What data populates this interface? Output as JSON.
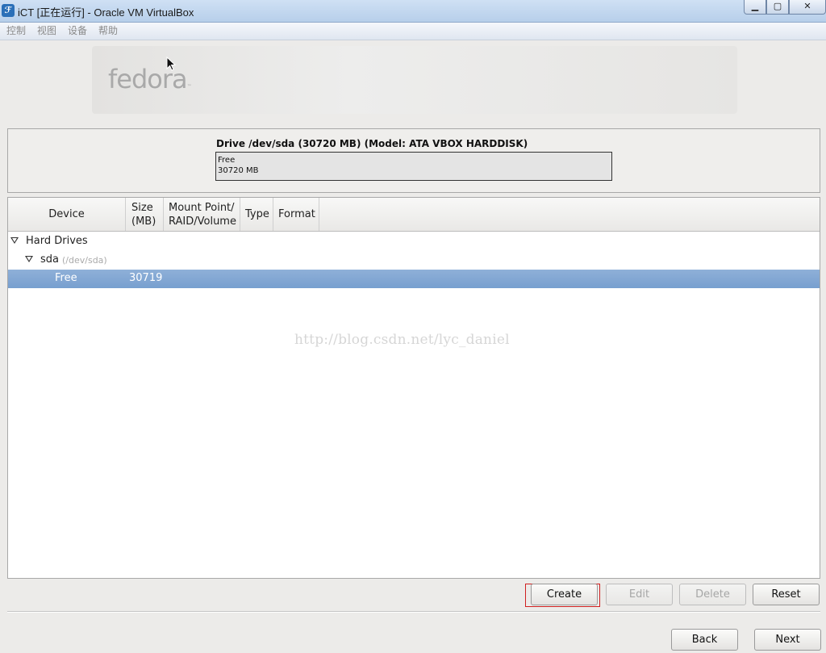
{
  "window": {
    "title": "iCT [正在运行] - Oracle VM VirtualBox",
    "controls": {
      "minimize": "▁",
      "maximize": "▢",
      "close": "✕"
    }
  },
  "menubar": {
    "items": [
      {
        "label": "控制"
      },
      {
        "label": "视图"
      },
      {
        "label": "设备"
      },
      {
        "label": "帮助"
      }
    ]
  },
  "installer": {
    "logo_text": "fedora",
    "logo_tm": "™",
    "drive": {
      "title": "Drive /dev/sda (30720 MB) (Model: ATA VBOX HARDDISK)",
      "bar_label": "Free",
      "bar_size": "30720 MB"
    },
    "tree": {
      "columns": {
        "device": "Device",
        "size_line1": "Size",
        "size_line2": "(MB)",
        "mount_line1": "Mount Point/",
        "mount_line2": "RAID/Volume",
        "type": "Type",
        "format": "Format"
      },
      "rows": [
        {
          "label": "Hard Drives"
        },
        {
          "label": "sda",
          "sub": "(/dev/sda)"
        },
        {
          "label": "Free",
          "size": "30719",
          "selected": true
        }
      ]
    },
    "watermark": "http://blog.csdn.net/lyc_daniel",
    "buttons": {
      "create": "Create",
      "edit": "Edit",
      "delete": "Delete",
      "reset": "Reset",
      "back": "Back",
      "next": "Next"
    }
  }
}
